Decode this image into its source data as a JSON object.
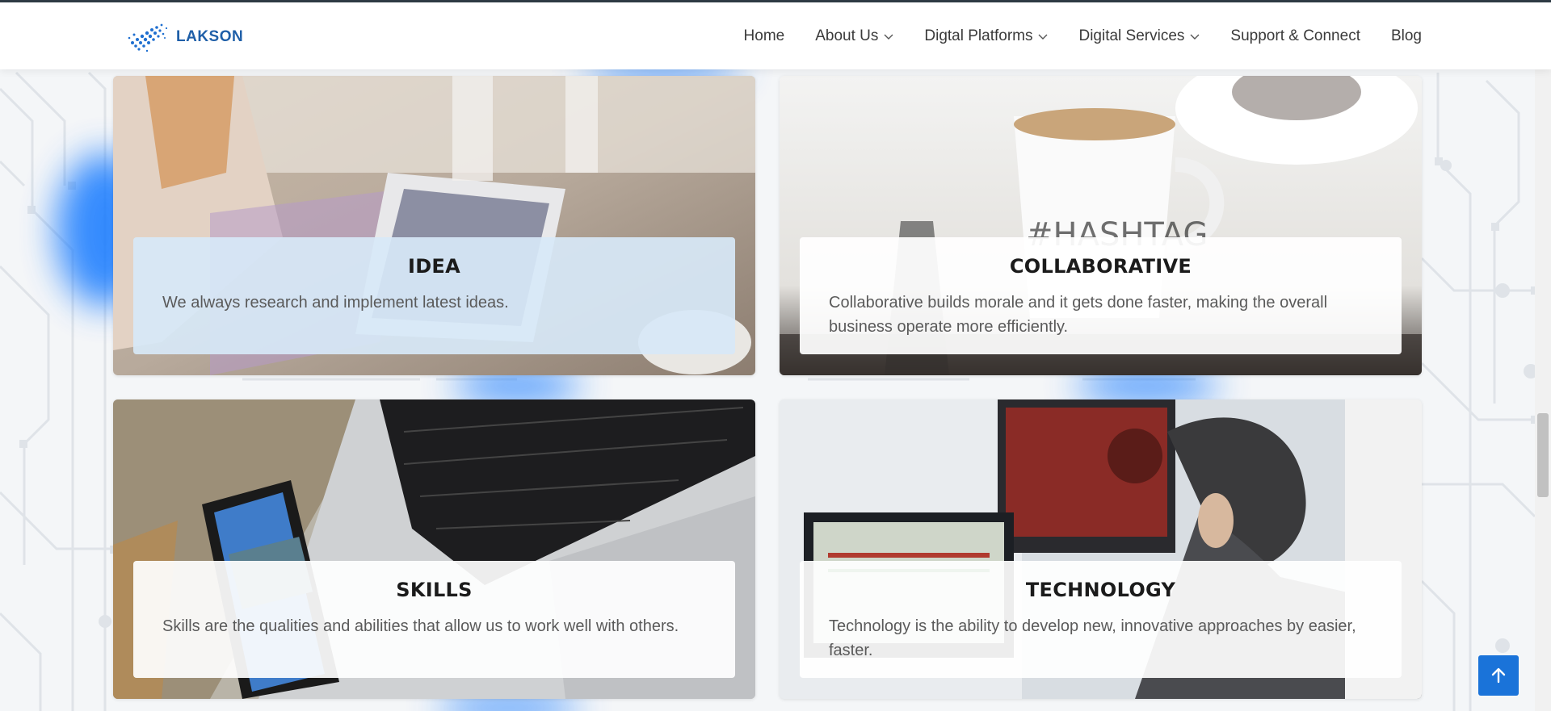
{
  "brand": {
    "name": "LAKSON"
  },
  "nav": {
    "items": [
      {
        "label": "Home",
        "has_dropdown": false
      },
      {
        "label": "About Us",
        "has_dropdown": true
      },
      {
        "label": "Digtal Platforms",
        "has_dropdown": true
      },
      {
        "label": "Digital Services",
        "has_dropdown": true
      },
      {
        "label": "Support & Connect",
        "has_dropdown": false
      },
      {
        "label": "Blog",
        "has_dropdown": false
      }
    ]
  },
  "cards": [
    {
      "title": "IDEA",
      "text": "We always research and implement latest ideas."
    },
    {
      "title": "COLLABORATIVE",
      "text": "Collaborative builds morale and it gets done faster, making the overall business operate more efficiently."
    },
    {
      "title": "SKILLS",
      "text": "Skills are the qualities and abilities that allow us to work well with others."
    },
    {
      "title": "TECHNOLOGY",
      "text": "Technology is the ability to develop new, innovative approaches by easier, faster."
    }
  ],
  "colors": {
    "accent": "#1a73d9",
    "brand_blue": "#1f5fa8",
    "glow_blue": "#1479ff",
    "idea_overlay": "#d7e8f7"
  },
  "icons": {
    "logo": "lakson-logo-icon",
    "dropdown": "chevron-down-icon",
    "back_to_top": "arrow-up-icon"
  }
}
